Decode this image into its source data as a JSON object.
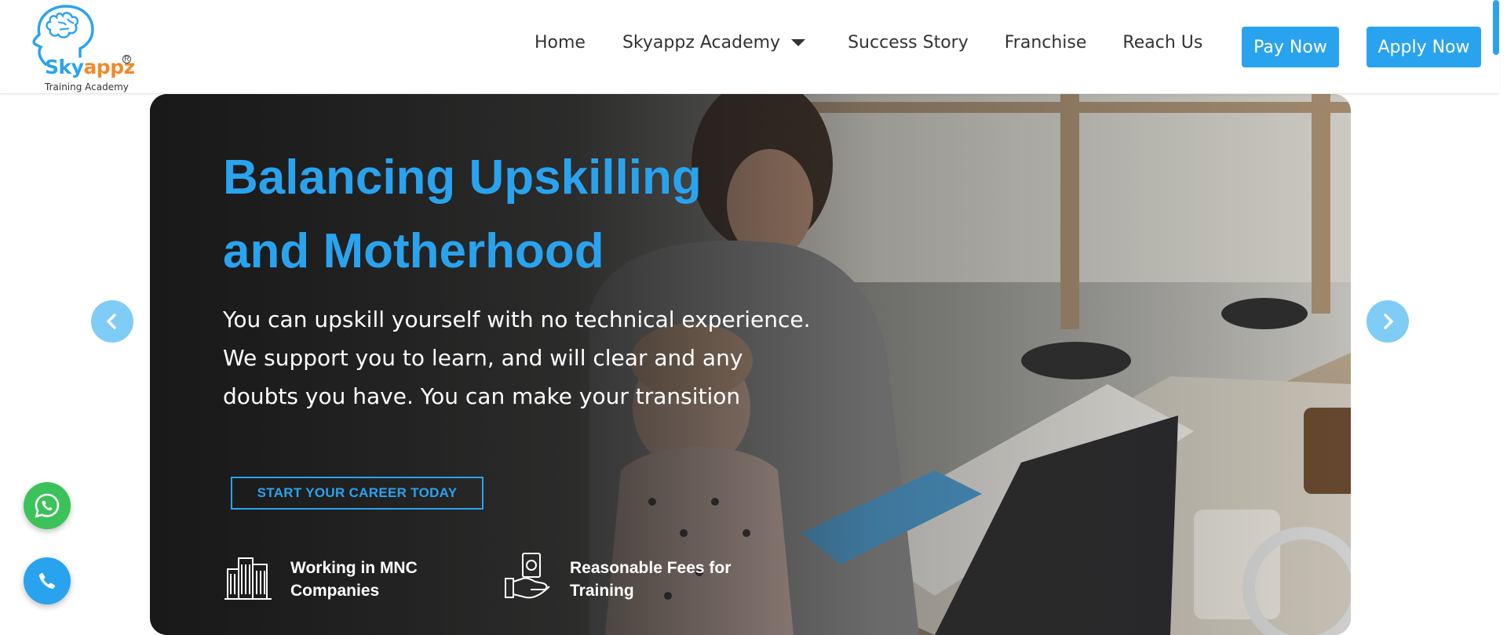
{
  "brand": {
    "name_part1": "Sky",
    "name_part2": "appz",
    "registered": "R",
    "tagline": "Training Academy",
    "colors": {
      "primary": "#2aa3ef",
      "accent": "#f08a2c"
    }
  },
  "nav": {
    "items": [
      {
        "label": "Home"
      },
      {
        "label": "Skyappz Academy",
        "has_dropdown": true
      },
      {
        "label": "Success Story"
      },
      {
        "label": "Franchise"
      },
      {
        "label": "Reach Us"
      }
    ],
    "pay_label": "Pay Now",
    "apply_label": "Apply Now"
  },
  "hero": {
    "title_line1": "Balancing Upskilling",
    "title_line2": "and Motherhood",
    "description": "You can upskill yourself with no technical experience. We support you to learn, and will clear and any doubts you have. You can make your transition",
    "cta_label": "START YOUR CAREER TODAY",
    "features": [
      {
        "icon": "buildings-icon",
        "text": "Working in MNC\nCompanies"
      },
      {
        "icon": "money-hand-icon",
        "text": "Reasonable Fees for\nTraining"
      }
    ]
  },
  "carousel": {
    "prev_icon": "chevron-left-icon",
    "next_icon": "chevron-right-icon"
  },
  "floating": {
    "whatsapp_icon": "whatsapp-icon",
    "call_icon": "phone-icon"
  }
}
